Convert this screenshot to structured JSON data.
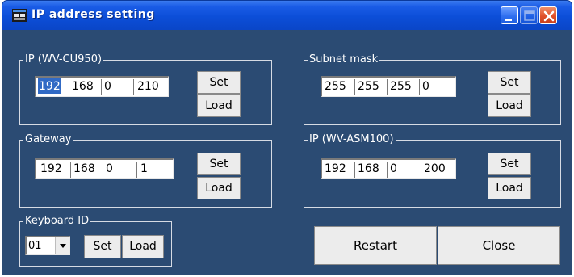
{
  "window": {
    "title": "IP address setting"
  },
  "groups": {
    "ip_cu950": {
      "label": "IP (WV-CU950)",
      "octets": [
        "192",
        "168",
        "0",
        "210"
      ]
    },
    "subnet": {
      "label": "Subnet mask",
      "octets": [
        "255",
        "255",
        "255",
        "0"
      ]
    },
    "gateway": {
      "label": "Gateway",
      "octets": [
        "192",
        "168",
        "0",
        "1"
      ]
    },
    "ip_asm100": {
      "label": "IP (WV-ASM100)",
      "octets": [
        "192",
        "168",
        "0",
        "200"
      ]
    },
    "keyboard": {
      "label": "Keyboard ID",
      "selected": "01"
    }
  },
  "buttons": {
    "set": "Set",
    "load": "Load",
    "restart": "Restart",
    "close": "Close"
  },
  "icons": {
    "app": "app-window-icon",
    "minimize": "minimize-icon",
    "maximize": "maximize-icon",
    "close": "close-icon",
    "dropdown": "chevron-down-icon"
  },
  "colors": {
    "window_bg": "#2b4b73",
    "titlebar": "#0c4ed8",
    "selection": "#316ac5",
    "close_button": "#e0502a"
  }
}
